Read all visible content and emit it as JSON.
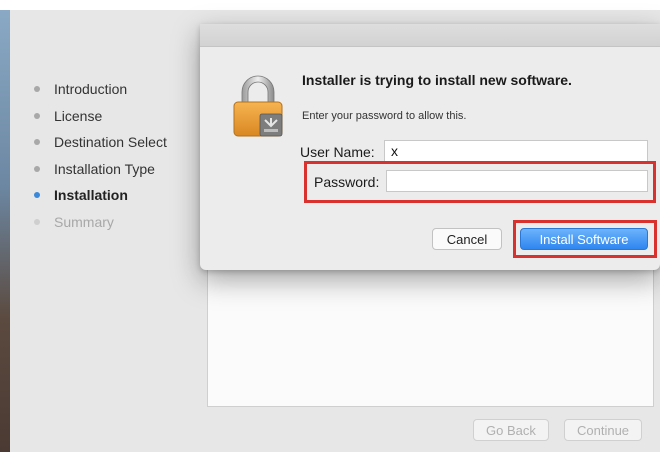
{
  "sidebar": {
    "steps": [
      {
        "label": "Introduction"
      },
      {
        "label": "License"
      },
      {
        "label": "Destination Select"
      },
      {
        "label": "Installation Type"
      },
      {
        "label": "Installation"
      },
      {
        "label": "Summary"
      }
    ],
    "active_step": "Installation"
  },
  "dialog": {
    "title": "Installer is trying to install new software.",
    "subtitle": "Enter your password to allow this.",
    "username_label": "User Name:",
    "username_value": "x",
    "password_label": "Password:",
    "password_value": "",
    "cancel_label": "Cancel",
    "install_label": "Install Software",
    "icon": "lock-icon"
  },
  "footer": {
    "back_label": "Go Back",
    "continue_label": "Continue"
  },
  "colors": {
    "accent": "#3a88d9",
    "highlight": "#d9322e"
  }
}
